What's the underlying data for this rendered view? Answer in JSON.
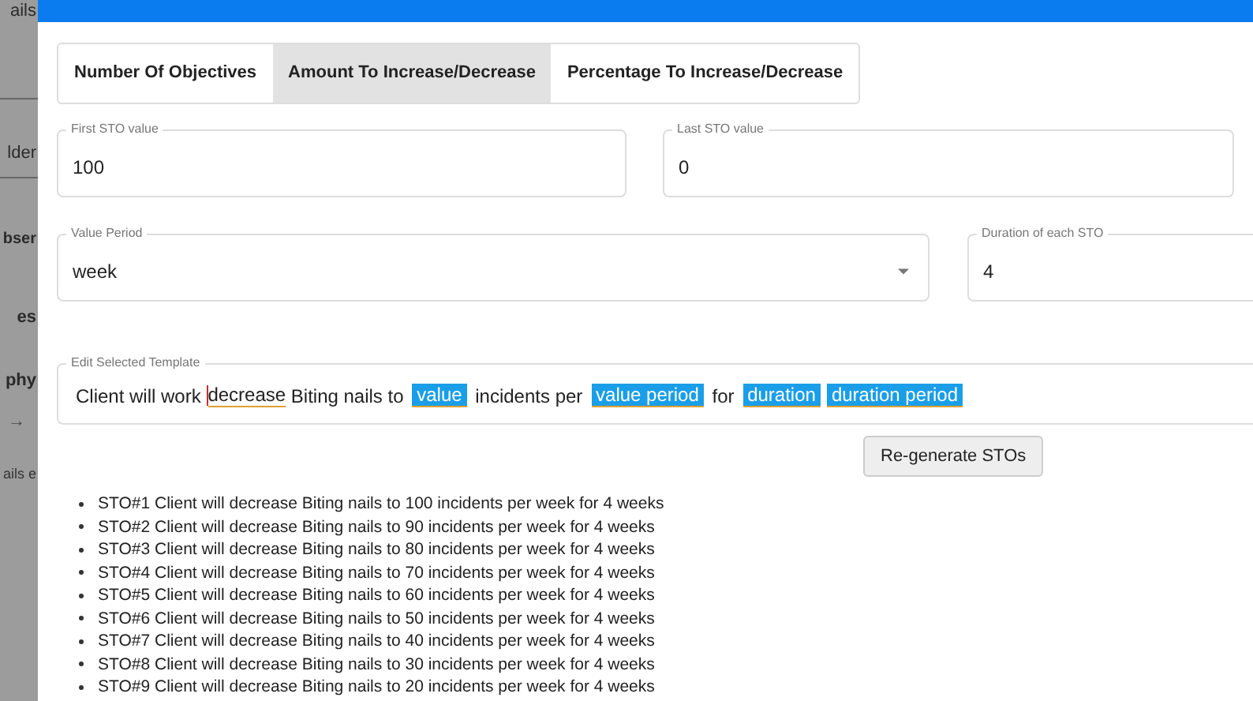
{
  "background_sidebar": {
    "items": [
      {
        "text": "ails"
      },
      {
        "text": "lder"
      },
      {
        "text": "bser"
      },
      {
        "text": "es"
      },
      {
        "text": "phy"
      },
      {
        "text": "→"
      },
      {
        "text": "ails e"
      }
    ]
  },
  "tabs": [
    {
      "label": "Number Of Objectives",
      "selected": false
    },
    {
      "label": "Amount To Increase/Decrease",
      "selected": true
    },
    {
      "label": "Percentage To Increase/Decrease",
      "selected": false
    }
  ],
  "fields": [
    {
      "kind": "text",
      "label": "First STO value",
      "value": "100"
    },
    {
      "kind": "text",
      "label": "Last STO value",
      "value": "0"
    },
    {
      "kind": "select",
      "label": "Value Period",
      "value": "week"
    },
    {
      "kind": "text",
      "label": "Duration of each STO",
      "value": "4"
    }
  ],
  "template": {
    "label": "Edit Selected Template",
    "segments": [
      {
        "kind": "text",
        "text": "Client will work "
      },
      {
        "kind": "misspelled",
        "text": "decrease"
      },
      {
        "kind": "text",
        "text": " Biting nails to "
      },
      {
        "kind": "variable",
        "text": "value"
      },
      {
        "kind": "text",
        "text": " incidents per "
      },
      {
        "kind": "variable",
        "text": "value period"
      },
      {
        "kind": "text",
        "text": " for "
      },
      {
        "kind": "variable",
        "text": "duration"
      },
      {
        "kind": "variable",
        "text": "duration period"
      }
    ]
  },
  "regenerate_button": "Re-generate STOs",
  "stos": [
    "STO#1 Client will decrease Biting nails to 100 incidents per week for 4 weeks",
    "STO#2 Client will decrease Biting nails to 90 incidents per week for 4 weeks",
    "STO#3 Client will decrease Biting nails to 80 incidents per week for 4 weeks",
    "STO#4 Client will decrease Biting nails to 70 incidents per week for 4 weeks",
    "STO#5 Client will decrease Biting nails to 60 incidents per week for 4 weeks",
    "STO#6 Client will decrease Biting nails to 50 incidents per week for 4 weeks",
    "STO#7 Client will decrease Biting nails to 40 incidents per week for 4 weeks",
    "STO#8 Client will decrease Biting nails to 30 incidents per week for 4 weeks",
    "STO#9 Client will decrease Biting nails to 20 incidents per week for 4 weeks"
  ]
}
